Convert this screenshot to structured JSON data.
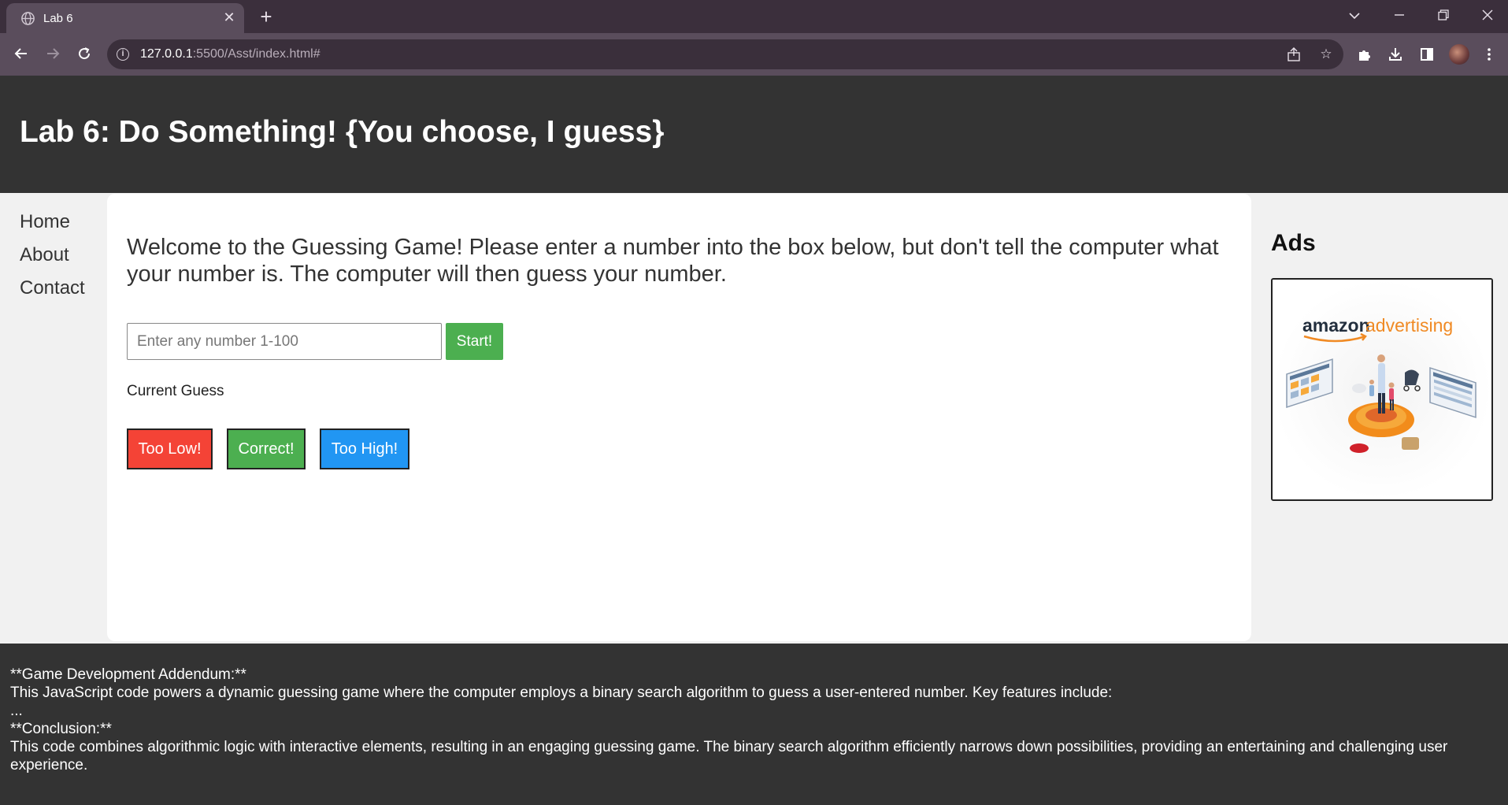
{
  "browser": {
    "tab_title": "Lab 6",
    "tab_close_glyph": "✕",
    "new_tab_glyph": "+",
    "url_host": "127.0.0.1",
    "url_path": ":5500/Asst/index.html#",
    "theme_color": "#5a4d5c"
  },
  "site": {
    "title": "Lab 6: Do Something! {You choose, I guess}",
    "nav": [
      {
        "label": "Home"
      },
      {
        "label": "About"
      },
      {
        "label": "Contact"
      }
    ]
  },
  "game": {
    "intro": "Welcome to the Guessing Game! Please enter a number into the box below, but don't tell the computer what your number is. The computer will then guess your number.",
    "input_placeholder": "Enter any number 1-100",
    "input_value": "",
    "start_label": "Start!",
    "current_guess_label": "Current Guess",
    "too_low_label": "Too Low!",
    "correct_label": "Correct!",
    "too_high_label": "Too High!",
    "colors": {
      "red": "#f44336",
      "green": "#4caf50",
      "blue": "#2196f3"
    }
  },
  "ads": {
    "title": "Ads",
    "brand_word1": "amazon",
    "brand_word2": "advertising"
  },
  "footer": {
    "line1": "**Game Development Addendum:**",
    "line2": "This JavaScript code powers a dynamic guessing game where the computer employs a binary search algorithm to guess a user-entered number. Key features include:",
    "line3": "...",
    "line4": "**Conclusion:**",
    "line5": "This code combines algorithmic logic with interactive elements, resulting in an engaging guessing game. The binary search algorithm efficiently narrows down possibilities, providing an entertaining and challenging user experience."
  }
}
